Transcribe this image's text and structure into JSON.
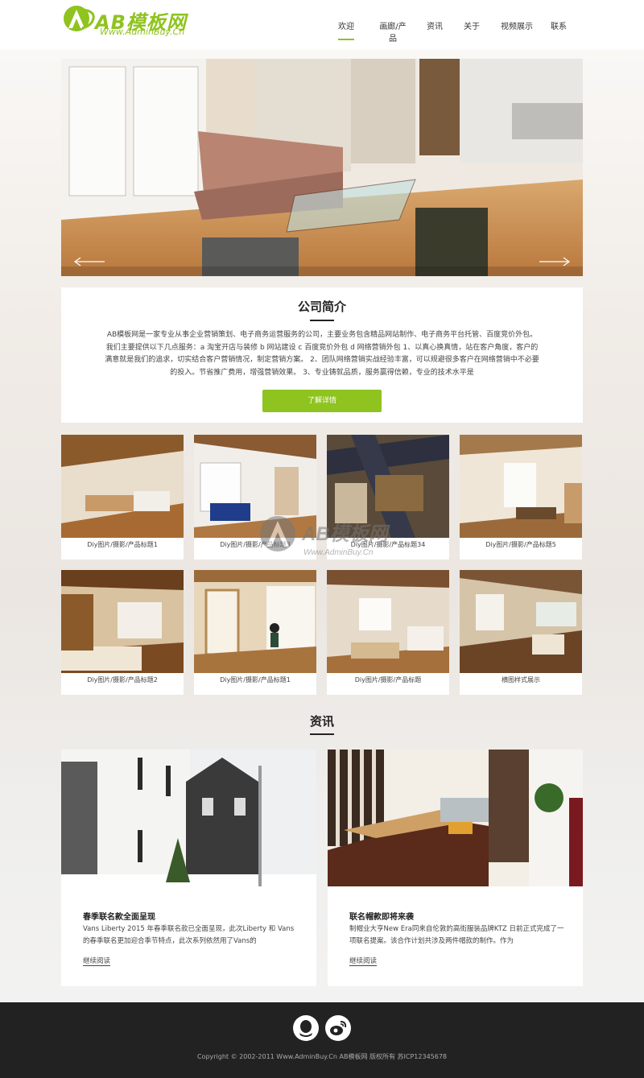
{
  "brand": {
    "name": "AB模板网",
    "url_text": "Www.AdminBuy.Cn",
    "accent": "#8fc31f"
  },
  "nav": {
    "items": [
      "欢迎",
      "画廊/产品",
      "资讯",
      "关于",
      "视频展示",
      "联系"
    ],
    "active_index": 0
  },
  "banner": {
    "prev_icon": "arrow-left-icon",
    "next_icon": "arrow-right-icon"
  },
  "intro": {
    "title": "公司简介",
    "text": "AB模板网是一家专业从事企业营销策划、电子商务运营服务的公司，主要业务包含精品网站制作、电子商务平台托管、百度竞价外包。 我们主要提供以下几点服务：a 淘宝开店与装修 b 网站建设 c 百度竞价外包 d 网络营销外包 1、以真心换真情，站在客户角度，客户的满意就是我们的追求，切实结合客户营销情况，制定营销方案。 2、团队网络营销实战经验丰富，可以规避很多客户在网络营销中不必要的投入。节省推广费用，增强营销效果。 3、专业铸就品质，服务赢得信赖，专业的技术水平是",
    "button": "了解详情"
  },
  "products": [
    {
      "caption": "Diy图片/摄影/产品标题1"
    },
    {
      "caption": "Diy图片/摄影/产品标题3"
    },
    {
      "caption": "Diy图片/摄影/产品标题34"
    },
    {
      "caption": "Diy图片/摄影/产品标题5"
    },
    {
      "caption": "Diy图片/摄影/产品标题2"
    },
    {
      "caption": "Diy图片/摄影/产品标题1"
    },
    {
      "caption": "Diy图片/摄影/产品标题"
    },
    {
      "caption": "横图样式展示"
    }
  ],
  "watermark": {
    "name": "AB模板网",
    "url": "Www.AdminBuy.Cn"
  },
  "news": {
    "title": "资讯",
    "items": [
      {
        "title": "春季联名款全面呈现",
        "summary": "Vans Liberty 2015 年春季联名款已全面呈现，此次Liberty 和 Vans 的春季联名更加迎合季节特点，此次系列依然用了Vans的",
        "more": "继续阅读"
      },
      {
        "title": "联名帽款即将来袭",
        "summary": "制帽业大亨New Era同来自伦敦的高街服装品牌KTZ 日前正式完成了一项联名提案。该合作计划共涉及两件帽款的制作。作为",
        "more": "继续阅读"
      }
    ]
  },
  "footer": {
    "icons": [
      "qq-icon",
      "weibo-icon"
    ],
    "copyright": "Copyright © 2002-2011 Www.AdminBuy.Cn AB模板网 版权所有 苏ICP12345678"
  }
}
